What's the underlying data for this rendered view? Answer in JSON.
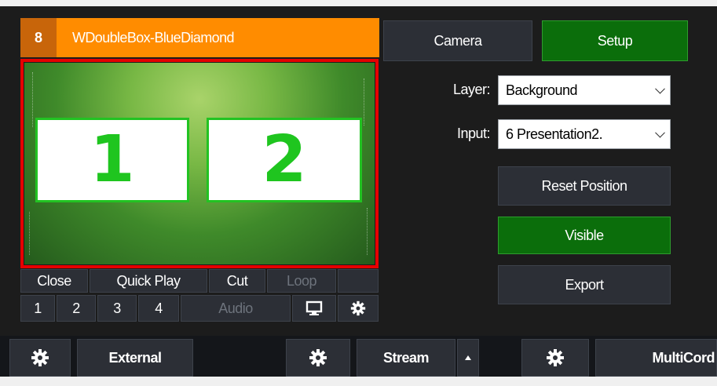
{
  "input": {
    "number": "8",
    "title": "WDoubleBox-BlueDiamond",
    "preview_box_1": "1",
    "preview_box_2": "2"
  },
  "input_buttons": {
    "close": "Close",
    "quick_play": "Quick Play",
    "cut": "Cut",
    "loop": "Loop",
    "overlay_1": "1",
    "overlay_2": "2",
    "overlay_3": "3",
    "overlay_4": "4",
    "audio": "Audio"
  },
  "panel": {
    "camera": "Camera",
    "setup": "Setup",
    "layer_label": "Layer:",
    "layer_value": "Background",
    "input_label": "Input:",
    "input_value": "6 Presentation2.",
    "reset_position": "Reset Position",
    "visible": "Visible",
    "export": "Export"
  },
  "bottom_bar": {
    "external": "External",
    "stream": "Stream",
    "multicorder": "MultiCord"
  },
  "icons": {
    "settings": "gear-icon",
    "monitor": "monitor-icon",
    "dropdown": "chevron-down-icon",
    "stream_menu": "caret-up-icon"
  },
  "colors": {
    "title_bar": "#ff8c00",
    "selected_border": "#e60000",
    "active_green": "#0b6e0b",
    "box_text_green": "#1fc51f"
  }
}
